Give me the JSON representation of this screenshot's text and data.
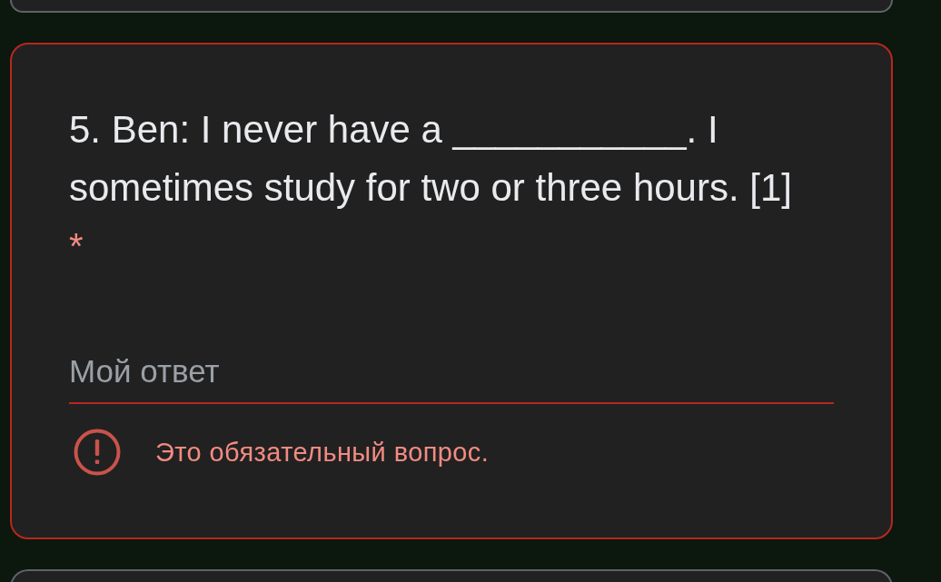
{
  "question": {
    "text": "5. Ben: I never have a ___________. I sometimes study for two or three hours. [1]",
    "required": true,
    "required_mark": "*",
    "has_error": true
  },
  "answer": {
    "placeholder": "Мой ответ"
  },
  "error": {
    "message": "Это обязательный вопрос."
  }
}
